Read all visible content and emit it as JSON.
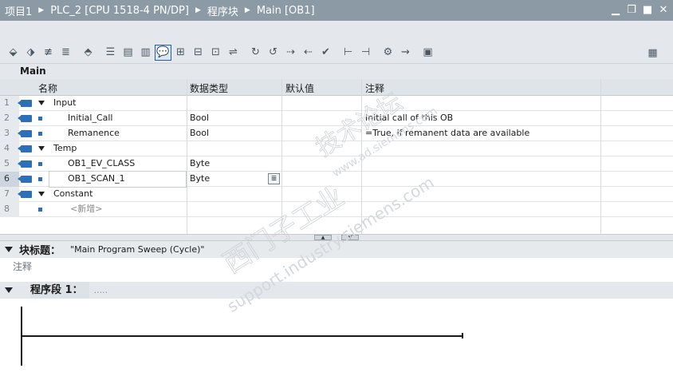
{
  "breadcrumb": [
    "项目1",
    "PLC_2 [CPU 1518-4 PN/DP]",
    "程序块",
    "Main [OB1]"
  ],
  "window_controls": [
    "minimize",
    "restore",
    "maximize",
    "close"
  ],
  "toolbar_icons": [
    "insert-network-icon",
    "delete-network-icon",
    "insert-row-icon",
    "add-row-icon",
    "open-all-icon",
    "absolute-operand-icon",
    "favorites-icon",
    "box-icon",
    "comment-icon",
    "show-symbol-icon",
    "show-address-icon",
    "network-comment-icon",
    "nav-icon",
    "monitor-icon",
    "compare-icon",
    "goto-icon",
    "goto-back-icon",
    "go-next-icon",
    "go-prev-icon",
    "check-icon",
    "breakpoint-icon",
    "stepping-icon",
    "load-icon",
    "monitor-online-icon",
    "settings-icon"
  ],
  "interface": {
    "block_name": "Main",
    "columns": {
      "name": "名称",
      "data_type": "数据类型",
      "default": "默认值",
      "comment": "注释"
    },
    "rows": [
      {
        "num": "1",
        "name": "Input",
        "type": "",
        "comment": "",
        "kind": "section"
      },
      {
        "num": "2",
        "name": "Initial_Call",
        "type": "Bool",
        "comment": "Initial call of this OB",
        "kind": "var"
      },
      {
        "num": "3",
        "name": "Remanence",
        "type": "Bool",
        "comment": "=True, if remanent data are available",
        "kind": "var"
      },
      {
        "num": "4",
        "name": "Temp",
        "type": "",
        "comment": "",
        "kind": "section"
      },
      {
        "num": "5",
        "name": "OB1_EV_CLASS",
        "type": "Byte",
        "comment": "",
        "kind": "var"
      },
      {
        "num": "6",
        "name": "OB1_SCAN_1",
        "type": "Byte",
        "comment": "",
        "kind": "var-selected"
      },
      {
        "num": "7",
        "name": "Constant",
        "type": "",
        "comment": "",
        "kind": "section"
      },
      {
        "num": "8",
        "name": "<新增>",
        "type": "",
        "comment": "",
        "kind": "new"
      }
    ]
  },
  "block_title": {
    "label": "块标题：",
    "value": "\"Main Program Sweep (Cycle)\"",
    "comment": "注释"
  },
  "network": {
    "label": "程序段 1：",
    "comment": "....."
  },
  "watermark": [
    "西门子工业",
    "support.industry.siemens.com",
    "技术论坛",
    "www.ad.siemens.com"
  ]
}
